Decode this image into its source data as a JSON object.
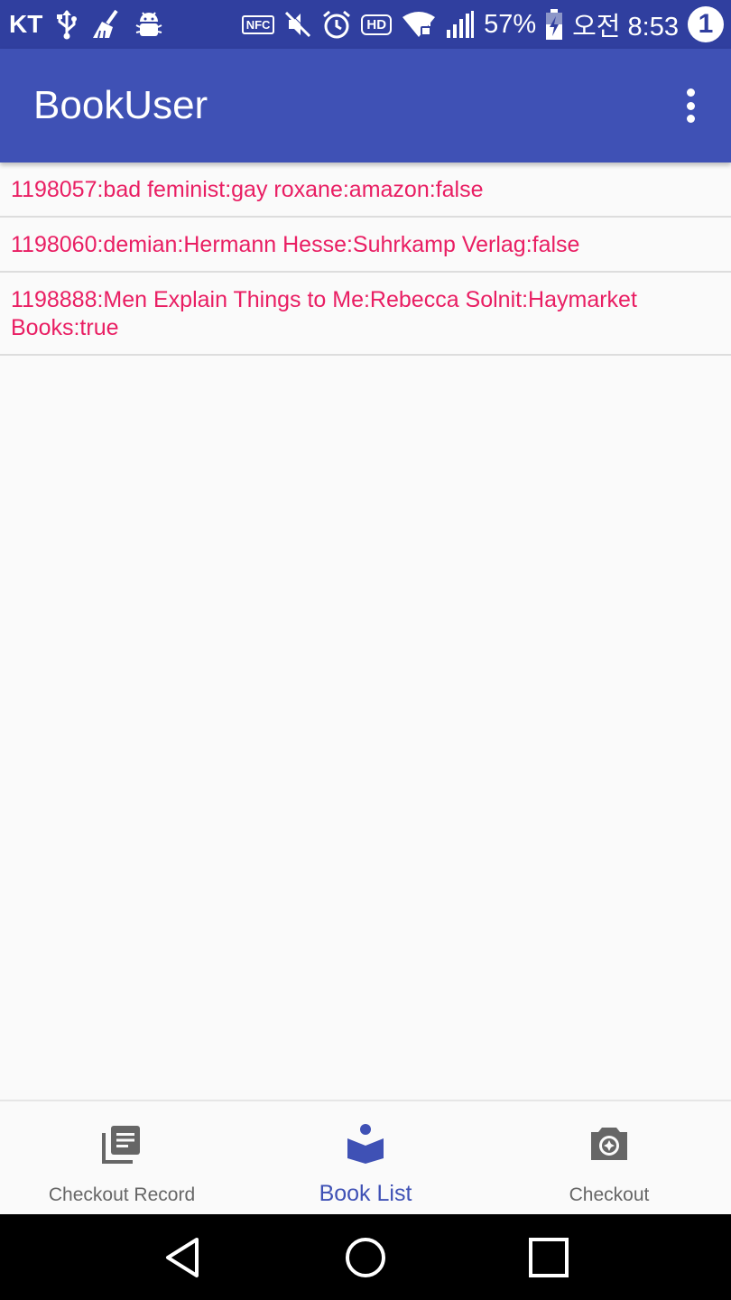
{
  "status_bar": {
    "carrier": "KT",
    "nfc": "NFC",
    "hd": "HD",
    "battery": "57%",
    "time": "오전 8:53",
    "notification_count": "1"
  },
  "app_bar": {
    "title": "BookUser"
  },
  "book_list": {
    "items": [
      {
        "text": "1198057:bad feminist:gay roxane:amazon:false"
      },
      {
        "text": "1198060:demian:Hermann Hesse:Suhrkamp Verlag:false"
      },
      {
        "text": "1198888:Men Explain Things to Me:Rebecca Solnit:Haymarket Books:true"
      }
    ]
  },
  "bottom_nav": {
    "items": [
      {
        "label": "Checkout Record",
        "icon": "library-books-icon",
        "active": false
      },
      {
        "label": "Book List",
        "icon": "book-reader-icon",
        "active": true
      },
      {
        "label": "Checkout",
        "icon": "camera-icon",
        "active": false
      }
    ]
  },
  "colors": {
    "status_bar": "#303f9f",
    "app_bar": "#3f51b5",
    "accent": "#e91e63",
    "nav_active": "#3f51b5",
    "nav_inactive": "#666666"
  }
}
